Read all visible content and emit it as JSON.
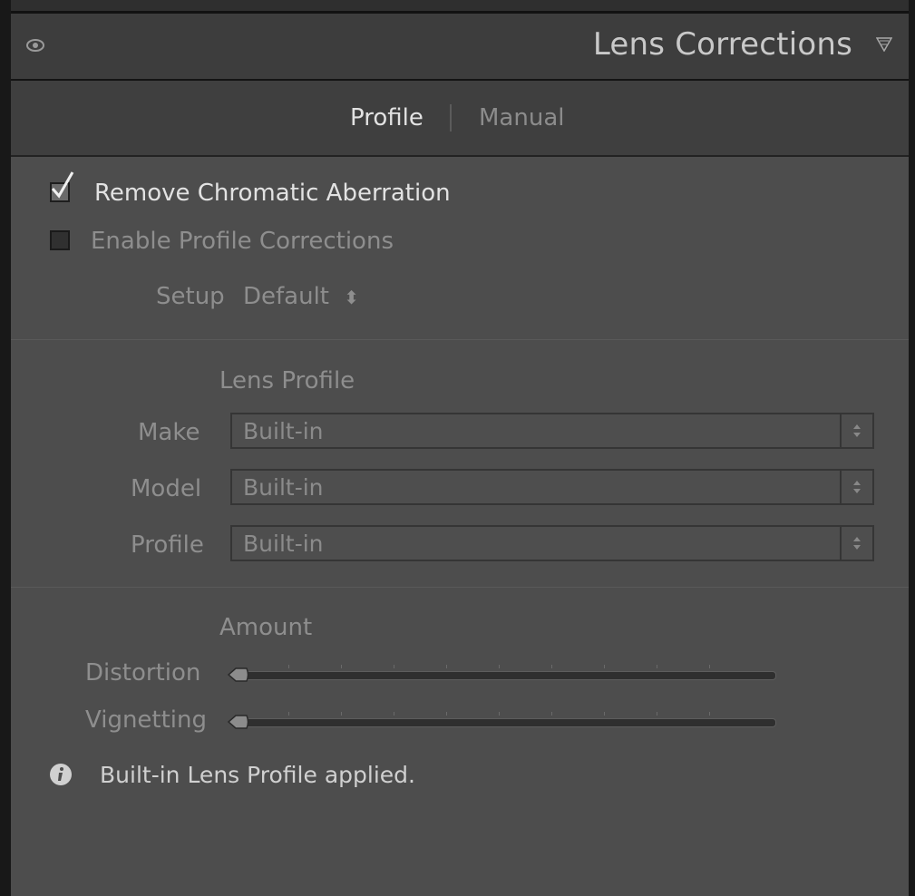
{
  "panel": {
    "title": "Lens Corrections",
    "tabs": [
      {
        "label": "Profile",
        "active": true
      },
      {
        "label": "Manual",
        "active": false
      }
    ]
  },
  "options": {
    "remove_ca": {
      "label": "Remove Chromatic Aberration",
      "checked": true
    },
    "enable_profile": {
      "label": "Enable Profile Corrections",
      "checked": false
    },
    "setup": {
      "label": "Setup",
      "value": "Default"
    }
  },
  "lens_profile": {
    "heading": "Lens Profile",
    "make": {
      "label": "Make",
      "value": "Built-in"
    },
    "model": {
      "label": "Model",
      "value": "Built-in"
    },
    "profile": {
      "label": "Profile",
      "value": "Built-in"
    }
  },
  "amount": {
    "heading": "Amount",
    "distortion": {
      "label": "Distortion",
      "value_fraction": 0.0
    },
    "vignetting": {
      "label": "Vignetting",
      "value_fraction": 0.0
    }
  },
  "status": {
    "text": "Built-in Lens Profile applied."
  },
  "colors": {
    "background": "#4d4d4d",
    "header": "#3d3d3d",
    "text": "#cfcfcf",
    "dim_text": "#8e8e8e"
  }
}
